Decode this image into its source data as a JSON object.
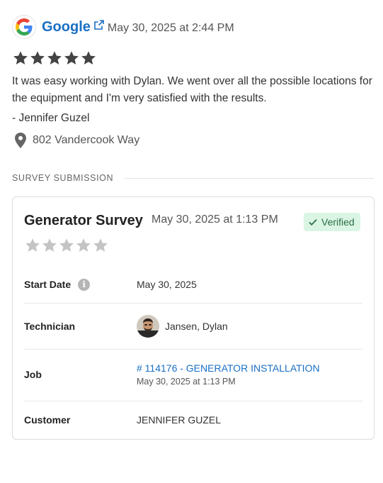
{
  "review": {
    "source": "Google",
    "date": "May 30, 2025 at 2:44 PM",
    "rating": 5,
    "text": "It was easy working with Dylan. We went over all the possible locations for the equipment and I'm very satisfied with the results.",
    "reviewer": "- Jennifer Guzel",
    "address": "802 Vandercook Way"
  },
  "colors": {
    "link": "#1a6fc4",
    "star_filled": "#444444",
    "star_empty": "#c4c4c4",
    "verified_bg": "#daf5e4",
    "verified_text": "#2c6e47"
  },
  "section": {
    "title": "SURVEY SUBMISSION"
  },
  "survey": {
    "title": "Generator Survey",
    "date": "May 30, 2025 at 1:13 PM",
    "badge": "Verified",
    "rating": 0,
    "rows": {
      "start_date": {
        "label": "Start Date",
        "value": "May 30, 2025"
      },
      "technician": {
        "label": "Technician",
        "value": "Jansen, Dylan"
      },
      "job": {
        "label": "Job",
        "link": "# 114176 - GENERATOR INSTALLATION",
        "date": "May 30, 2025 at 1:13 PM"
      },
      "customer": {
        "label": "Customer",
        "value": "JENNIFER GUZEL"
      }
    }
  },
  "icons": [
    "google-logo-icon",
    "external-link-icon",
    "star-icon",
    "map-pin-icon",
    "checkmark-icon",
    "info-icon",
    "avatar-icon"
  ]
}
